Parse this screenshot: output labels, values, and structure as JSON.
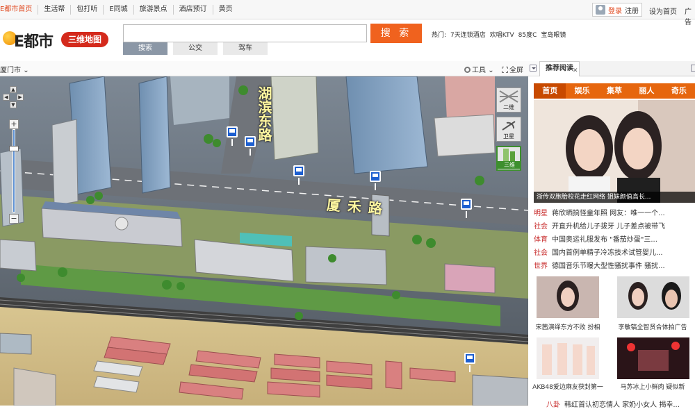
{
  "topnav": {
    "items": [
      "E都市首页",
      "生活帮",
      "包打听",
      "E同城",
      "旅游景点",
      "酒店预订",
      "黄页"
    ],
    "login": "登录",
    "register": "注册",
    "set_home": "设为首页",
    "ad": "广告"
  },
  "header": {
    "logo_text": "E都市",
    "map3d_label": "三维地图",
    "search_placeholder": "",
    "search_button": "搜 索",
    "modes": [
      "搜索",
      "公交",
      "驾车"
    ],
    "active_mode": "搜索",
    "hot_label": "热门:",
    "hot_items": [
      "7天连锁酒店",
      "欢唱KTV",
      "85度C",
      "宝岛眼镜"
    ]
  },
  "toolbar": {
    "city": "厦门市",
    "tools": "工具",
    "fullscreen": "全屏"
  },
  "map": {
    "layers": [
      "二维",
      "卫星",
      "三维"
    ],
    "active_layer": "三维",
    "road_labels": [
      "湖滨东路",
      "厦禾路"
    ]
  },
  "sidebar": {
    "tab_title": "推荐阅读",
    "categories": [
      "首页",
      "娱乐",
      "集萃",
      "丽人",
      "奇乐"
    ],
    "active_category": "首页",
    "hero_caption": "浙传双胞胎校花走红网络 姐妹颜值高长...",
    "news": [
      {
        "tag": "明星",
        "text": "蒋欣晒搞怪童年照 网友：唯一一个..."
      },
      {
        "tag": "社会",
        "text": "开直升机给儿子拔牙 儿子差点被带飞"
      },
      {
        "tag": "体育",
        "text": "中国奥运礼服发布 \"番茄炒蛋\"三..."
      },
      {
        "tag": "社会",
        "text": "国内首例单精子冷冻技术试管婴儿..."
      },
      {
        "tag": "世界",
        "text": "德国音乐节曝大型性骚扰事件 骚扰..."
      }
    ],
    "thumbs": [
      {
        "caption": "宋茜演绎东方不败 扮相"
      },
      {
        "caption": "李敏镐全智贤合体拍广告"
      },
      {
        "caption": "AKB48爱边麻友获封第一"
      },
      {
        "caption": "马苏冰上小鲜肉 疑似新"
      }
    ],
    "bottom_tag": "八卦",
    "bottom_text": "韩红首认初恋情人 家奶小女人 揭幸..."
  },
  "colors": {
    "accent": "#f0621e",
    "brand_red": "#d42a1c",
    "category_orange": "#e6660e",
    "news_tag": "#c82c2c",
    "bus_blue": "#1d5fd0"
  }
}
